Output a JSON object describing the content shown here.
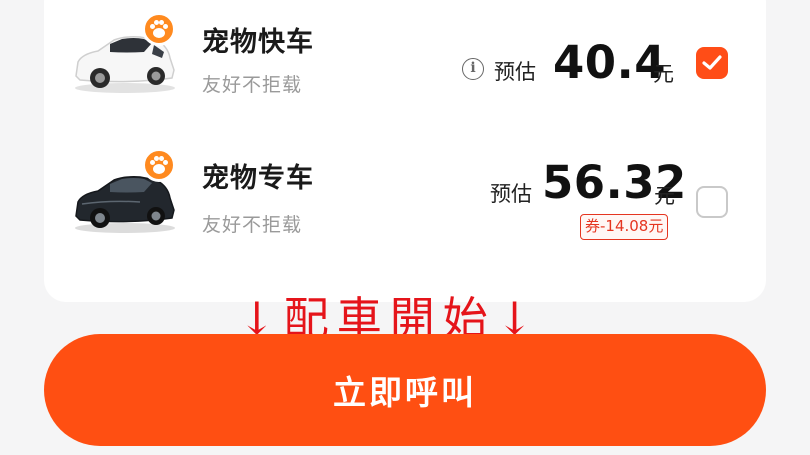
{
  "options": [
    {
      "name": "宠物快车",
      "subtitle": "友好不拒载",
      "estimate_label": "预估",
      "price": "40.4",
      "unit": "元",
      "selected": true,
      "car_color": "#f4f4f4"
    },
    {
      "name": "宠物专车",
      "subtitle": "友好不拒载",
      "estimate_label": "预估",
      "price": "56.32",
      "unit": "元",
      "coupon": "券-14.08元",
      "selected": false,
      "car_color": "#1f2328"
    }
  ],
  "info_icon_glyph": "i",
  "annotation": "↓配車開始↓",
  "call_button": "立即呼叫",
  "colors": {
    "accent": "#ff4f12",
    "checkbox_checked": "#ff4d17",
    "paw_badge": "#ff8a1f",
    "coupon": "#e53520",
    "annotation": "#e5141a"
  },
  "icons": [
    "pet-paw-icon",
    "info-icon",
    "check-icon",
    "white-car-icon",
    "black-car-icon"
  ]
}
